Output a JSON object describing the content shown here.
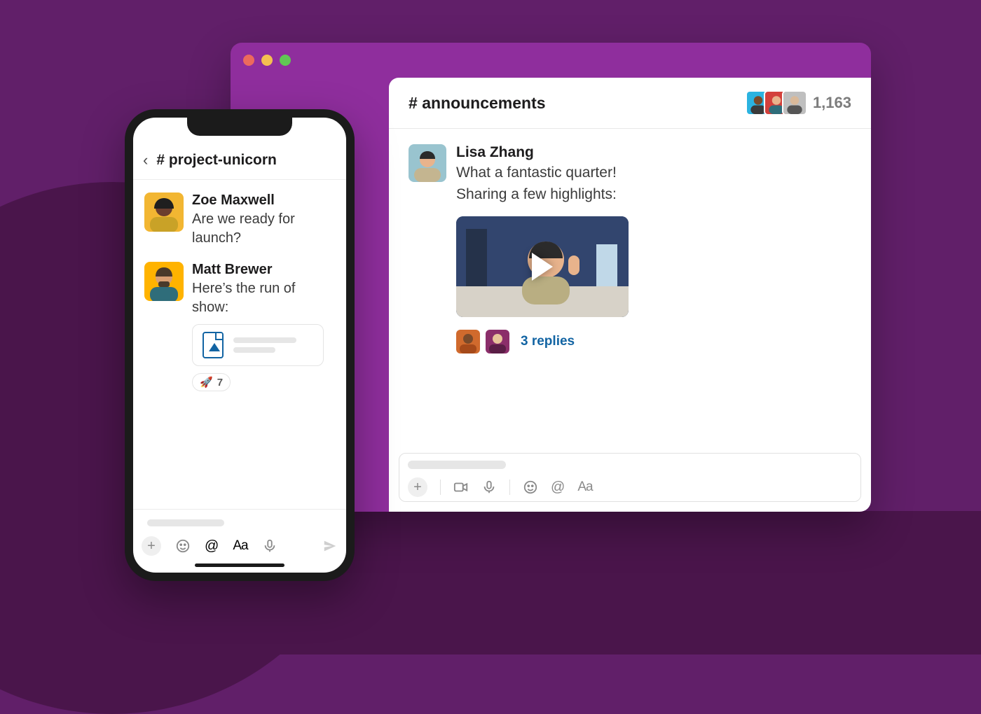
{
  "phone": {
    "channel_prefix": "#",
    "channel": "project-unicorn",
    "messages": [
      {
        "author": "Zoe Maxwell",
        "text": "Are we ready for launch?",
        "avatar_bg": "#f2b632"
      },
      {
        "author": "Matt Brewer",
        "text": "Here’s the run of show:",
        "avatar_bg": "#ffb300",
        "reaction": {
          "emoji": "🚀",
          "count": "7"
        }
      }
    ],
    "icons": [
      "plus",
      "emoji",
      "mention",
      "text-format",
      "microphone",
      "send"
    ]
  },
  "desktop": {
    "window_dots": [
      "#ec6a5d",
      "#f4bf50",
      "#61c654"
    ],
    "channel_prefix": "#",
    "channel": "announcements",
    "member_count": "1,163",
    "header_avatars": [
      "#2bb3e0",
      "#d3403b",
      "#bfbfbf"
    ],
    "message": {
      "author": "Lisa Zhang",
      "line1": "What a fantastic quarter!",
      "line2": "Sharing a few highlights:",
      "avatar_bg": "#99c4cf"
    },
    "replies": {
      "avatars": [
        "#d06a2d",
        "#8b2e6a"
      ],
      "label": "3 replies"
    },
    "composer_icons": [
      "plus",
      "video",
      "microphone",
      "emoji",
      "mention",
      "text-format"
    ]
  }
}
